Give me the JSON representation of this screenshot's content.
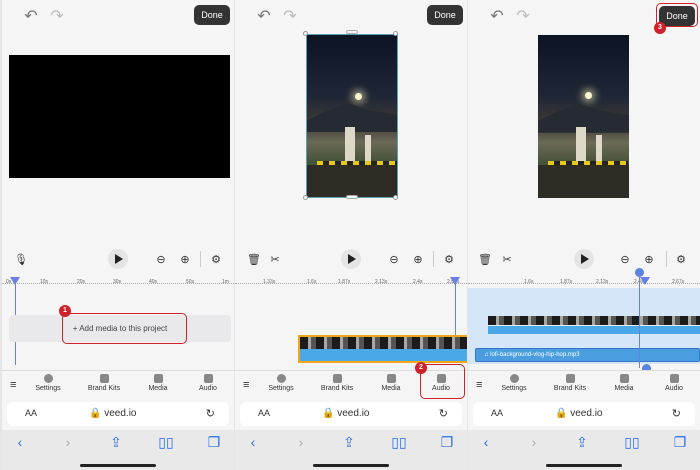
{
  "common": {
    "done_label": "Done",
    "url": "veed.io",
    "url_aa": "AA",
    "undo_icon": "↶",
    "redo_icon": "↷",
    "menu_icon": "≡",
    "nav": [
      "Settings",
      "Brand Kits",
      "Media",
      "Audio"
    ]
  },
  "panel1": {
    "add_media_label": "+ Add media to this project",
    "badge": "1",
    "ruler": [
      "0s",
      "10s",
      "20s",
      "30s",
      "40s",
      "50s",
      "1m"
    ]
  },
  "panel2": {
    "badge": "2",
    "ruler": [
      "1.33s",
      "1.6s",
      "1.87s",
      "2.13s",
      "2.4s",
      "2.67s"
    ]
  },
  "panel3": {
    "badge": "3",
    "ruler": [
      "1.6s",
      "1.87s",
      "2.13s",
      "2.4s",
      "2.67s"
    ],
    "audio_track_label": "lofi-background-vlog-hip-hop.mp3"
  },
  "colors": {
    "highlight": "#d0202a",
    "playhead": "#6a7ee8",
    "audio": "#4a9ee0",
    "clip_border": "#f0a818",
    "safari_blue": "#2a6ee8"
  }
}
